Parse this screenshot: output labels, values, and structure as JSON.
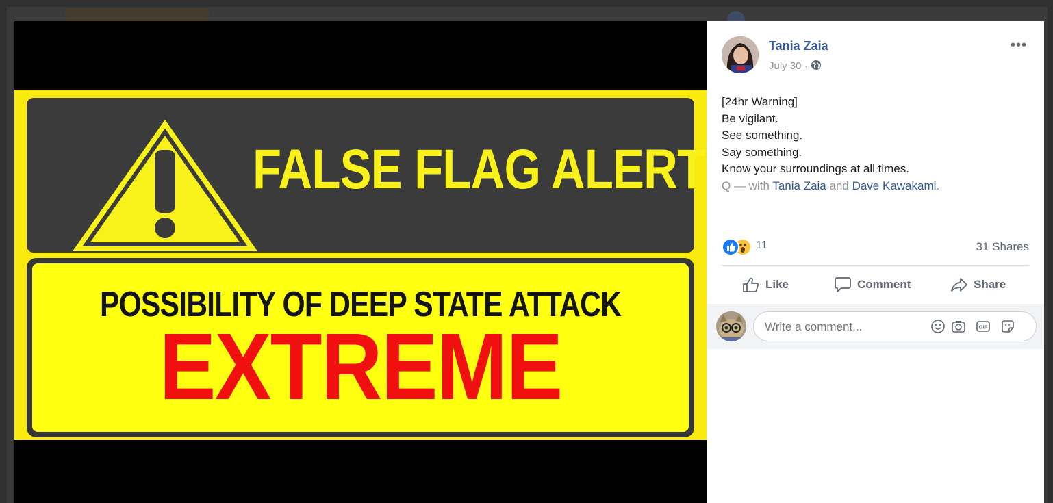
{
  "post": {
    "author_name": "Tania Zaia",
    "date": "July 30",
    "meta_separator": "·",
    "more_label": "•••",
    "text_lines": [
      "[24hr Warning]",
      "Be vigilant.",
      "See something.",
      "Say something.",
      "Know your surroundings at all times."
    ],
    "tag_prefix": "Q — with ",
    "tag_person_1": "Tania Zaia",
    "tag_and": " and ",
    "tag_person_2": "Dave Kawakami",
    "tag_suffix": "."
  },
  "image": {
    "headline": "FALSE FLAG ALERT",
    "line2": "POSSIBILITY OF DEEP STATE ATTACK",
    "line3": "EXTREME"
  },
  "engagement": {
    "reaction_count": "11",
    "shares": "31 Shares",
    "reaction_icons": [
      "like-icon",
      "wow-icon"
    ]
  },
  "actions": {
    "like": "Like",
    "comment": "Comment",
    "share": "Share"
  },
  "comment_box": {
    "placeholder": "Write a comment...",
    "icons": [
      "emoji-icon",
      "camera-icon",
      "gif-icon",
      "sticker-icon"
    ]
  },
  "colors": {
    "link": "#385898",
    "sign_yellow": "#f7ea0c",
    "sign_red": "#f01010",
    "like_blue": "#1877f2"
  }
}
